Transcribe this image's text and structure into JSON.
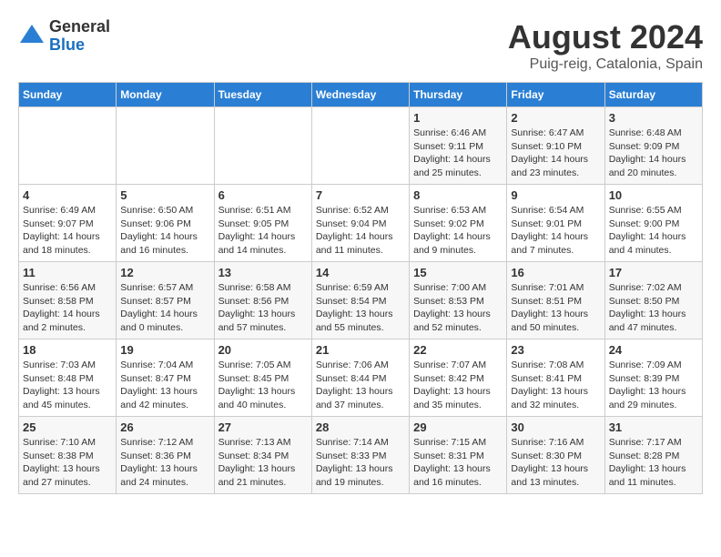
{
  "header": {
    "logo_general": "General",
    "logo_blue": "Blue",
    "main_title": "August 2024",
    "subtitle": "Puig-reig, Catalonia, Spain"
  },
  "calendar": {
    "days_of_week": [
      "Sunday",
      "Monday",
      "Tuesday",
      "Wednesday",
      "Thursday",
      "Friday",
      "Saturday"
    ],
    "weeks": [
      [
        {
          "day": "",
          "info": ""
        },
        {
          "day": "",
          "info": ""
        },
        {
          "day": "",
          "info": ""
        },
        {
          "day": "",
          "info": ""
        },
        {
          "day": "1",
          "info": "Sunrise: 6:46 AM\nSunset: 9:11 PM\nDaylight: 14 hours\nand 25 minutes."
        },
        {
          "day": "2",
          "info": "Sunrise: 6:47 AM\nSunset: 9:10 PM\nDaylight: 14 hours\nand 23 minutes."
        },
        {
          "day": "3",
          "info": "Sunrise: 6:48 AM\nSunset: 9:09 PM\nDaylight: 14 hours\nand 20 minutes."
        }
      ],
      [
        {
          "day": "4",
          "info": "Sunrise: 6:49 AM\nSunset: 9:07 PM\nDaylight: 14 hours\nand 18 minutes."
        },
        {
          "day": "5",
          "info": "Sunrise: 6:50 AM\nSunset: 9:06 PM\nDaylight: 14 hours\nand 16 minutes."
        },
        {
          "day": "6",
          "info": "Sunrise: 6:51 AM\nSunset: 9:05 PM\nDaylight: 14 hours\nand 14 minutes."
        },
        {
          "day": "7",
          "info": "Sunrise: 6:52 AM\nSunset: 9:04 PM\nDaylight: 14 hours\nand 11 minutes."
        },
        {
          "day": "8",
          "info": "Sunrise: 6:53 AM\nSunset: 9:02 PM\nDaylight: 14 hours\nand 9 minutes."
        },
        {
          "day": "9",
          "info": "Sunrise: 6:54 AM\nSunset: 9:01 PM\nDaylight: 14 hours\nand 7 minutes."
        },
        {
          "day": "10",
          "info": "Sunrise: 6:55 AM\nSunset: 9:00 PM\nDaylight: 14 hours\nand 4 minutes."
        }
      ],
      [
        {
          "day": "11",
          "info": "Sunrise: 6:56 AM\nSunset: 8:58 PM\nDaylight: 14 hours\nand 2 minutes."
        },
        {
          "day": "12",
          "info": "Sunrise: 6:57 AM\nSunset: 8:57 PM\nDaylight: 14 hours\nand 0 minutes."
        },
        {
          "day": "13",
          "info": "Sunrise: 6:58 AM\nSunset: 8:56 PM\nDaylight: 13 hours\nand 57 minutes."
        },
        {
          "day": "14",
          "info": "Sunrise: 6:59 AM\nSunset: 8:54 PM\nDaylight: 13 hours\nand 55 minutes."
        },
        {
          "day": "15",
          "info": "Sunrise: 7:00 AM\nSunset: 8:53 PM\nDaylight: 13 hours\nand 52 minutes."
        },
        {
          "day": "16",
          "info": "Sunrise: 7:01 AM\nSunset: 8:51 PM\nDaylight: 13 hours\nand 50 minutes."
        },
        {
          "day": "17",
          "info": "Sunrise: 7:02 AM\nSunset: 8:50 PM\nDaylight: 13 hours\nand 47 minutes."
        }
      ],
      [
        {
          "day": "18",
          "info": "Sunrise: 7:03 AM\nSunset: 8:48 PM\nDaylight: 13 hours\nand 45 minutes."
        },
        {
          "day": "19",
          "info": "Sunrise: 7:04 AM\nSunset: 8:47 PM\nDaylight: 13 hours\nand 42 minutes."
        },
        {
          "day": "20",
          "info": "Sunrise: 7:05 AM\nSunset: 8:45 PM\nDaylight: 13 hours\nand 40 minutes."
        },
        {
          "day": "21",
          "info": "Sunrise: 7:06 AM\nSunset: 8:44 PM\nDaylight: 13 hours\nand 37 minutes."
        },
        {
          "day": "22",
          "info": "Sunrise: 7:07 AM\nSunset: 8:42 PM\nDaylight: 13 hours\nand 35 minutes."
        },
        {
          "day": "23",
          "info": "Sunrise: 7:08 AM\nSunset: 8:41 PM\nDaylight: 13 hours\nand 32 minutes."
        },
        {
          "day": "24",
          "info": "Sunrise: 7:09 AM\nSunset: 8:39 PM\nDaylight: 13 hours\nand 29 minutes."
        }
      ],
      [
        {
          "day": "25",
          "info": "Sunrise: 7:10 AM\nSunset: 8:38 PM\nDaylight: 13 hours\nand 27 minutes."
        },
        {
          "day": "26",
          "info": "Sunrise: 7:12 AM\nSunset: 8:36 PM\nDaylight: 13 hours\nand 24 minutes."
        },
        {
          "day": "27",
          "info": "Sunrise: 7:13 AM\nSunset: 8:34 PM\nDaylight: 13 hours\nand 21 minutes."
        },
        {
          "day": "28",
          "info": "Sunrise: 7:14 AM\nSunset: 8:33 PM\nDaylight: 13 hours\nand 19 minutes."
        },
        {
          "day": "29",
          "info": "Sunrise: 7:15 AM\nSunset: 8:31 PM\nDaylight: 13 hours\nand 16 minutes."
        },
        {
          "day": "30",
          "info": "Sunrise: 7:16 AM\nSunset: 8:30 PM\nDaylight: 13 hours\nand 13 minutes."
        },
        {
          "day": "31",
          "info": "Sunrise: 7:17 AM\nSunset: 8:28 PM\nDaylight: 13 hours\nand 11 minutes."
        }
      ]
    ]
  }
}
